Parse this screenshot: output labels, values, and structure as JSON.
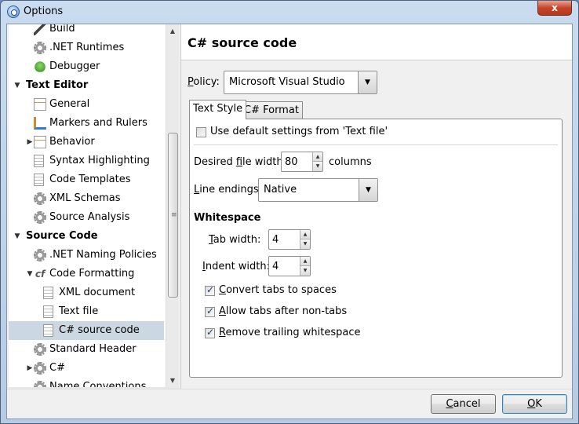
{
  "window": {
    "title": "Options",
    "close_label": "x"
  },
  "tree": {
    "items": [
      {
        "label": "Build",
        "icon": "pen-icon",
        "bold": false,
        "twisty": ""
      },
      {
        "label": ".NET Runtimes",
        "icon": "gear-icon",
        "bold": false,
        "twisty": ""
      },
      {
        "label": "Debugger",
        "icon": "bug-icon",
        "bold": false,
        "twisty": ""
      },
      {
        "label": "Text Editor",
        "icon": "",
        "bold": true,
        "twisty": "▼"
      },
      {
        "label": "General",
        "icon": "page-pen-icon",
        "bold": false,
        "twisty": ""
      },
      {
        "label": "Markers and Rulers",
        "icon": "markers-icon",
        "bold": false,
        "twisty": ""
      },
      {
        "label": "Behavior",
        "icon": "page-pen-icon",
        "bold": false,
        "twisty": "▶"
      },
      {
        "label": "Syntax Highlighting",
        "icon": "page-icon",
        "bold": false,
        "twisty": ""
      },
      {
        "label": "Code Templates",
        "icon": "page-icon",
        "bold": false,
        "twisty": ""
      },
      {
        "label": "XML Schemas",
        "icon": "gear-icon",
        "bold": false,
        "twisty": ""
      },
      {
        "label": "Source Analysis",
        "icon": "gear-icon",
        "bold": false,
        "twisty": ""
      },
      {
        "label": "Source Code",
        "icon": "",
        "bold": true,
        "twisty": "▼"
      },
      {
        "label": ".NET Naming Policies",
        "icon": "gear-icon",
        "bold": false,
        "twisty": ""
      },
      {
        "label": "Code Formatting",
        "icon": "code-formatting-icon",
        "bold": false,
        "twisty": "▼"
      },
      {
        "label": "XML document",
        "icon": "page-icon",
        "bold": false,
        "twisty": ""
      },
      {
        "label": "Text file",
        "icon": "page-icon",
        "bold": false,
        "twisty": ""
      },
      {
        "label": "C# source code",
        "icon": "page-icon",
        "bold": false,
        "twisty": "",
        "selected": true
      },
      {
        "label": "Standard Header",
        "icon": "gear-icon",
        "bold": false,
        "twisty": ""
      },
      {
        "label": "C#",
        "icon": "gear-icon",
        "bold": false,
        "twisty": "▶"
      },
      {
        "label": "Name Conventions",
        "icon": "gear-icon",
        "bold": false,
        "twisty": ""
      }
    ]
  },
  "panel": {
    "title": "C# source code",
    "policy_label": "Policy:",
    "policy_value": "Microsoft Visual Studio",
    "tabs": [
      {
        "label": "Text Style"
      },
      {
        "label": "C# Format"
      }
    ],
    "use_default_label": "Use default settings from 'Text file'",
    "desired_width_label": "Desired file width:",
    "desired_width_value": "80",
    "columns_label": "columns",
    "line_endings_label": "Line endings:",
    "line_endings_value": "Native",
    "whitespace_heading": "Whitespace",
    "tab_width_label": "Tab width:",
    "tab_width_value": "4",
    "indent_width_label": "Indent width:",
    "indent_width_value": "4",
    "convert_tabs_label": "Convert tabs to spaces",
    "allow_tabs_label": "Allow tabs after non-tabs",
    "remove_trailing_label": "Remove trailing whitespace"
  },
  "footer": {
    "cancel_label": "Cancel",
    "ok_label": "OK"
  },
  "accent": "#cbd7e1"
}
